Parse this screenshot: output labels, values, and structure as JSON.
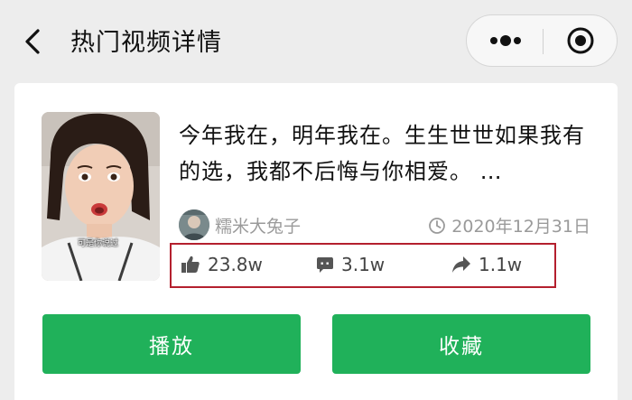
{
  "header": {
    "title": "热门视频详情"
  },
  "video": {
    "title": "今年我在，明年我在。生生世世如果我有的选，我都不后悔与你相爱。 …",
    "author": "糯米大兔子",
    "date": "2020年12月31日",
    "thumbnail_caption": "可是你说过",
    "stats": {
      "likes": "23.8w",
      "comments": "3.1w",
      "shares": "1.1w"
    }
  },
  "actions": {
    "play_label": "播放",
    "favorite_label": "收藏"
  },
  "colors": {
    "accent_green": "#20b15a",
    "highlight_red": "#b4202e",
    "text_muted": "#9a9a9a",
    "background": "#ededed"
  },
  "icons": [
    "back-arrow-icon",
    "more-dots-icon",
    "close-target-icon",
    "clock-icon",
    "thumbs-up-icon",
    "comment-icon",
    "share-icon"
  ]
}
